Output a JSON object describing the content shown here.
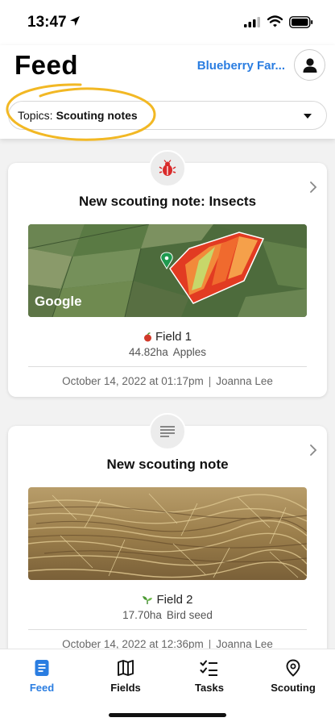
{
  "status_bar": {
    "time": "13:47"
  },
  "header": {
    "title": "Feed",
    "farm_name": "Blueberry Far...",
    "topics": {
      "prefix": "Topics:",
      "value": "Scouting notes"
    }
  },
  "colors": {
    "accent": "#2a7de1",
    "highlight": "#f2b824",
    "badge_bug": "#d92b2b"
  },
  "cards": [
    {
      "badge_icon": "bug-icon",
      "title": "New scouting note: Insects",
      "image_icon": "field-map-image",
      "map_brand": "Google",
      "field_icon": "apple-icon",
      "field_name": "Field 1",
      "area": "44.82ha",
      "crop": "Apples",
      "date": "October 14, 2022 at 01:17pm",
      "separator": "|",
      "author": "Joanna Lee"
    },
    {
      "badge_icon": "note-lines-icon",
      "title": "New scouting note",
      "image_icon": "dry-grass-photo",
      "field_icon": "seedling-icon",
      "field_name": "Field 2",
      "area": "17.70ha",
      "crop": "Bird seed",
      "date": "October 14, 2022 at 12:36pm",
      "separator": "|",
      "author": "Joanna Lee"
    }
  ],
  "tabs": [
    {
      "label": "Feed",
      "icon": "document-icon",
      "active": true
    },
    {
      "label": "Fields",
      "icon": "map-icon",
      "active": false
    },
    {
      "label": "Tasks",
      "icon": "checklist-icon",
      "active": false
    },
    {
      "label": "Scouting",
      "icon": "location-pin-icon",
      "active": false
    }
  ]
}
